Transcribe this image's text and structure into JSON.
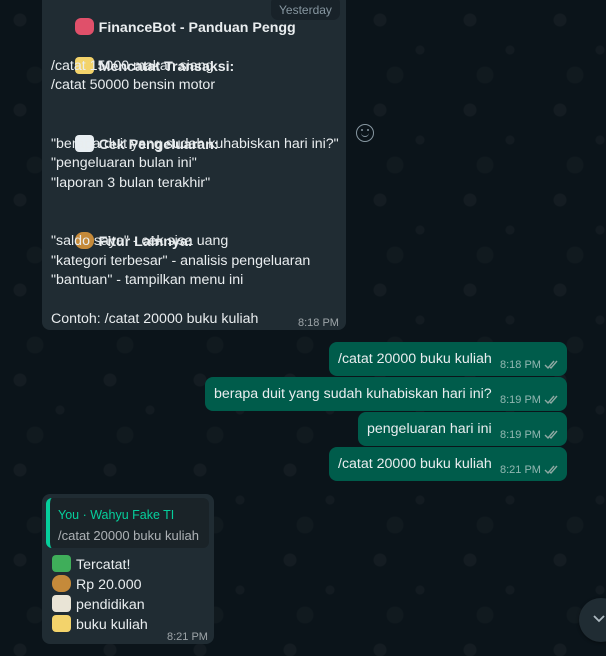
{
  "day_separator": "Yesterday",
  "help_message": {
    "title": "FinanceBot - Panduan Pengg",
    "section_record": "Mencatat Transaksi:",
    "record_lines": [
      "/catat 15000 makan siang",
      "/catat 50000 bensin motor"
    ],
    "section_expense": "Cek Pengeluaran:",
    "expense_lines": [
      "\"berapa duit yang sudah kuhabiskan hari ini?\"",
      "\"pengeluaran bulan ini\"",
      "\"laporan 3 bulan terakhir\""
    ],
    "section_other": "Fitur Lainnya:",
    "other_lines": [
      "\"saldo saya\" - cek sisa uang",
      "\"kategori terbesar\" - analisis pengeluaran",
      "\"bantuan\" - tampilkan menu ini"
    ],
    "example": "Contoh: /catat 20000 buku kuliah",
    "time": "8:18 PM"
  },
  "outgoing": [
    {
      "text": "/catat 20000 buku kuliah",
      "time": "8:18 PM"
    },
    {
      "text": "berapa duit yang sudah kuhabiskan hari ini?",
      "time": "8:19 PM"
    },
    {
      "text": "pengeluaran hari ini",
      "time": "8:19 PM"
    },
    {
      "text": "/catat 20000 buku kuliah",
      "time": "8:21 PM"
    }
  ],
  "reply_message": {
    "quote_author": "You · Wahyu Fake TI",
    "quote_text": "/catat 20000 buku kuliah",
    "lines": [
      "Tercatat!",
      "Rp 20.000",
      "pendidikan",
      "buku kuliah"
    ],
    "time": "8:21 PM"
  },
  "icons": {
    "bot": "robot-icon",
    "memo": "memo-icon",
    "chart": "bar-chart-icon",
    "money": "money-bag-icon",
    "check": "check-mark-icon",
    "tag": "tag-icon",
    "emoji": "emoji-icon",
    "scroll": "chevron-down-icon"
  },
  "colors": {
    "background": "#0b141a",
    "incoming_bubble": "#202c33",
    "outgoing_bubble": "#005c4b",
    "read_ticks": "#53bdeb",
    "accent": "#06cf9c"
  }
}
